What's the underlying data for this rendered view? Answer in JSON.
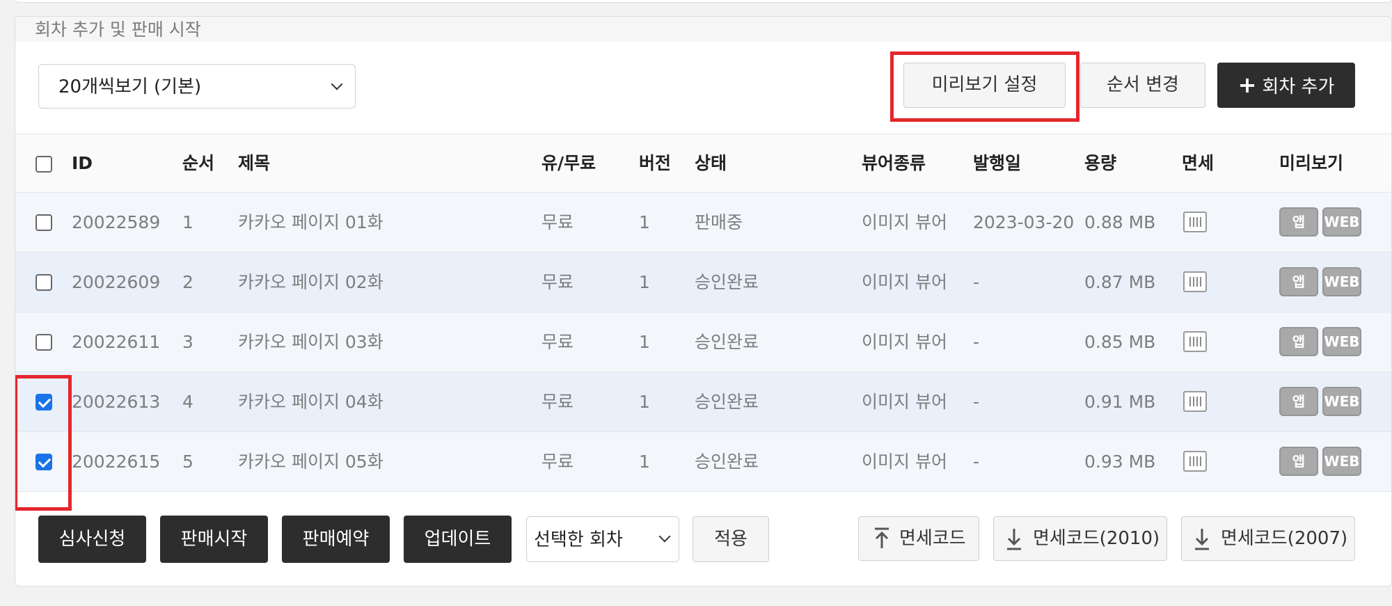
{
  "panel": {
    "title": "회차 추가 및 판매 시작"
  },
  "toolbar": {
    "page_size_select": "20개씩보기 (기본)",
    "preview_settings_label": "미리보기 설정",
    "reorder_label": "순서 변경",
    "add_episode_label": "회차 추가",
    "add_icon": "+"
  },
  "table": {
    "headers": {
      "id": "ID",
      "order": "순서",
      "title": "제목",
      "paid": "유/무료",
      "version": "버전",
      "status": "상태",
      "viewer": "뷰어종류",
      "date": "발행일",
      "size": "용량",
      "tax": "면세",
      "preview": "미리보기"
    },
    "rows": [
      {
        "checked": false,
        "id": "20022589",
        "order": "1",
        "title": "카카오 페이지 01화",
        "paid": "무료",
        "version": "1",
        "status": "판매중",
        "viewer": "이미지 뷰어",
        "date": "2023-03-20",
        "size": "0.88 MB",
        "app": "앱",
        "web": "WEB"
      },
      {
        "checked": false,
        "id": "20022609",
        "order": "2",
        "title": "카카오 페이지 02화",
        "paid": "무료",
        "version": "1",
        "status": "승인완료",
        "viewer": "이미지 뷰어",
        "date": "-",
        "size": "0.87 MB",
        "app": "앱",
        "web": "WEB"
      },
      {
        "checked": false,
        "id": "20022611",
        "order": "3",
        "title": "카카오 페이지 03화",
        "paid": "무료",
        "version": "1",
        "status": "승인완료",
        "viewer": "이미지 뷰어",
        "date": "-",
        "size": "0.85 MB",
        "app": "앱",
        "web": "WEB"
      },
      {
        "checked": true,
        "id": "20022613",
        "order": "4",
        "title": "카카오 페이지 04화",
        "paid": "무료",
        "version": "1",
        "status": "승인완료",
        "viewer": "이미지 뷰어",
        "date": "-",
        "size": "0.91 MB",
        "app": "앱",
        "web": "WEB"
      },
      {
        "checked": true,
        "id": "20022615",
        "order": "5",
        "title": "카카오 페이지 05화",
        "paid": "무료",
        "version": "1",
        "status": "승인완료",
        "viewer": "이미지 뷰어",
        "date": "-",
        "size": "0.93 MB",
        "app": "앱",
        "web": "WEB"
      }
    ]
  },
  "bottom": {
    "review_label": "심사신청",
    "start_sale_label": "판매시작",
    "reserve_sale_label": "판매예약",
    "update_label": "업데이트",
    "target_select": "선택한 회차",
    "apply_label": "적용",
    "tax_upload_label": "면세코드",
    "tax_download_2010_label": "면세코드(2010)",
    "tax_download_2007_label": "면세코드(2007)"
  },
  "colors": {
    "highlight": "#e4262c",
    "dark_button": "#2d2d2d",
    "checkbox_checked": "#1a73e8"
  }
}
